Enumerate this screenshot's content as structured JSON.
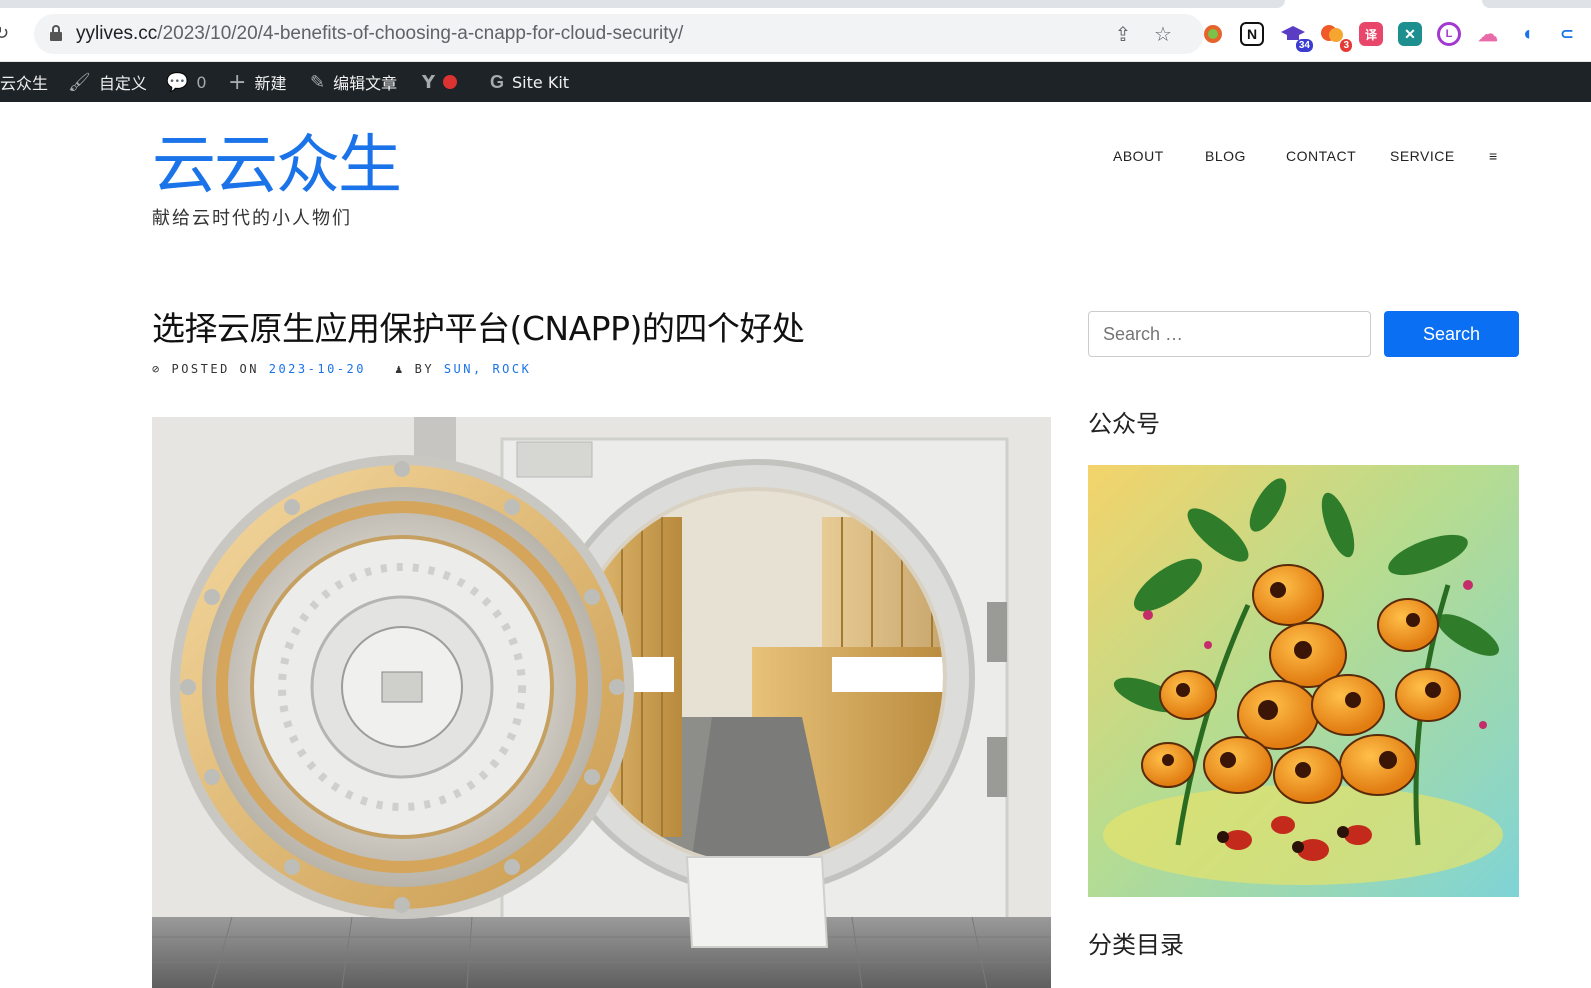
{
  "browser": {
    "url_host": "yylives.cc",
    "url_path": "/2023/10/20/4-benefits-of-choosing-a-cnapp-for-cloud-security/",
    "extensions": [
      {
        "name": "circle-ext-icon",
        "color": "#e8622c"
      },
      {
        "name": "notion-icon",
        "color": "#111111",
        "glyph": "N"
      },
      {
        "name": "grad-cap-ext-icon",
        "color": "#5b3cc4",
        "badge": "34",
        "badge_color": "#3b3bd1"
      },
      {
        "name": "orange-blob-ext-icon",
        "color": "#f05a28",
        "badge": "3",
        "badge_color": "#e53935"
      },
      {
        "name": "translate-ext-icon",
        "color": "#e8466a",
        "glyph": "译"
      },
      {
        "name": "cross-ext-icon",
        "color": "#1e8f8f",
        "glyph": "✕"
      },
      {
        "name": "purple-ring-ext-icon",
        "color": "#a23ad1",
        "glyph": "L"
      },
      {
        "name": "cloud-ext-icon",
        "color": "#e86aa8",
        "glyph": "☁"
      },
      {
        "name": "blue-mark-ext-icon",
        "color": "#1a73e8",
        "glyph": "◖"
      }
    ]
  },
  "adminbar": {
    "site": "云众生",
    "customize": "自定义",
    "comments": "0",
    "new": "新建",
    "edit": "编辑文章",
    "sitekit": "Site Kit"
  },
  "header": {
    "title": "云云众生",
    "tagline": "献给云时代的小人物们",
    "nav": [
      "ABOUT",
      "BLOG",
      "CONTACT",
      "SERVICE",
      "≡"
    ]
  },
  "post": {
    "title": "选择云原生应用保护平台(CNAPP)的四个好处",
    "posted_on_label": "POSTED ON",
    "date": "2023-10-20",
    "by_label": "BY",
    "author": "SUN, ROCK"
  },
  "sidebar": {
    "search_placeholder": "Search …",
    "search_button": "Search",
    "widget1_title": "公众号",
    "widget2_title": "分类目录"
  }
}
